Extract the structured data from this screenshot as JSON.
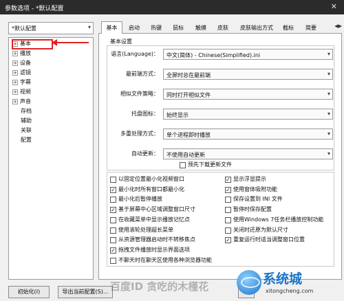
{
  "window": {
    "title": "参数选项 - *默认配置",
    "close": "✕"
  },
  "profile": {
    "selected": "*默认配置"
  },
  "tree": [
    {
      "label": "基本",
      "expand": "+"
    },
    {
      "label": "播放",
      "expand": "+"
    },
    {
      "label": "设备",
      "expand": "+"
    },
    {
      "label": "滤镜",
      "expand": "+"
    },
    {
      "label": "字幕",
      "expand": "+"
    },
    {
      "label": "视频",
      "expand": "+"
    },
    {
      "label": "声音",
      "expand": "+"
    },
    {
      "label": "存档",
      "expand": ""
    },
    {
      "label": "辅助",
      "expand": ""
    },
    {
      "label": "关联",
      "expand": ""
    },
    {
      "label": "配置",
      "expand": ""
    }
  ],
  "tabs": [
    "基本",
    "启动",
    "热键",
    "鼠标",
    "触摸",
    "皮肤",
    "皮肤输出方式",
    "截标",
    "简要"
  ],
  "panel": {
    "section_title": "基本设置",
    "rows": [
      {
        "label": "语言(Language)：",
        "value": "中文(简体) - Chinese(Simplified).ini"
      },
      {
        "label": "最前端方式：",
        "value": "全屏时总在最前端"
      },
      {
        "label": "相似文件策略：",
        "value": "同时打开相似文件"
      },
      {
        "label": "托盘图标：",
        "value": "始终显示"
      },
      {
        "label": "多重处理方式：",
        "value": "单个进程即时播放"
      },
      {
        "label": "自动更新：",
        "value": "不使用自动更新"
      }
    ],
    "predownload": {
      "label": "预先下载更新文件",
      "checked": false
    },
    "options_left": [
      {
        "label": "以固定位置最小化视频窗口",
        "checked": false
      },
      {
        "label": "最小化时所有窗口都最小化",
        "checked": true
      },
      {
        "label": "最小化后暂停播放",
        "checked": false
      },
      {
        "label": "基于屏幕中心区域调整窗口尺寸",
        "checked": true
      },
      {
        "label": "在收藏菜单中显示播放记忆点",
        "checked": false
      },
      {
        "label": "使用滚轮处理超长菜单",
        "checked": false
      },
      {
        "label": "从资源管理器启动时不转移焦点",
        "checked": false
      },
      {
        "label": "拖拽文件播放时显示界面选项",
        "checked": true
      },
      {
        "label": "不聊天时在聊天区使用各种浏览器功能",
        "checked": false
      }
    ],
    "options_right": [
      {
        "label": "显示浮显提示",
        "checked": true
      },
      {
        "label": "使用窗体吸附功能",
        "checked": true
      },
      {
        "label": "保存设置到 INI 文件",
        "checked": false
      },
      {
        "label": "暂停时保存配置",
        "checked": false
      },
      {
        "label": "使用Windows 7任务栏播放控制功能",
        "checked": false
      },
      {
        "label": "关闭时还原为默认尺寸",
        "checked": false
      },
      {
        "label": "重复运行时适当调整窗口位置",
        "checked": true
      }
    ]
  },
  "footer": {
    "init_button": "初始化(I)",
    "export_button": "导出当前配置(S)...",
    "confirm_button": "确"
  },
  "overlay": {
    "watermark": "百度ID 贪吃的木槿花",
    "brand": "系统城",
    "url": "xitongcheng.com"
  },
  "colors": {
    "highlight": "#e02020",
    "titlebar": "#2b2b2b"
  }
}
